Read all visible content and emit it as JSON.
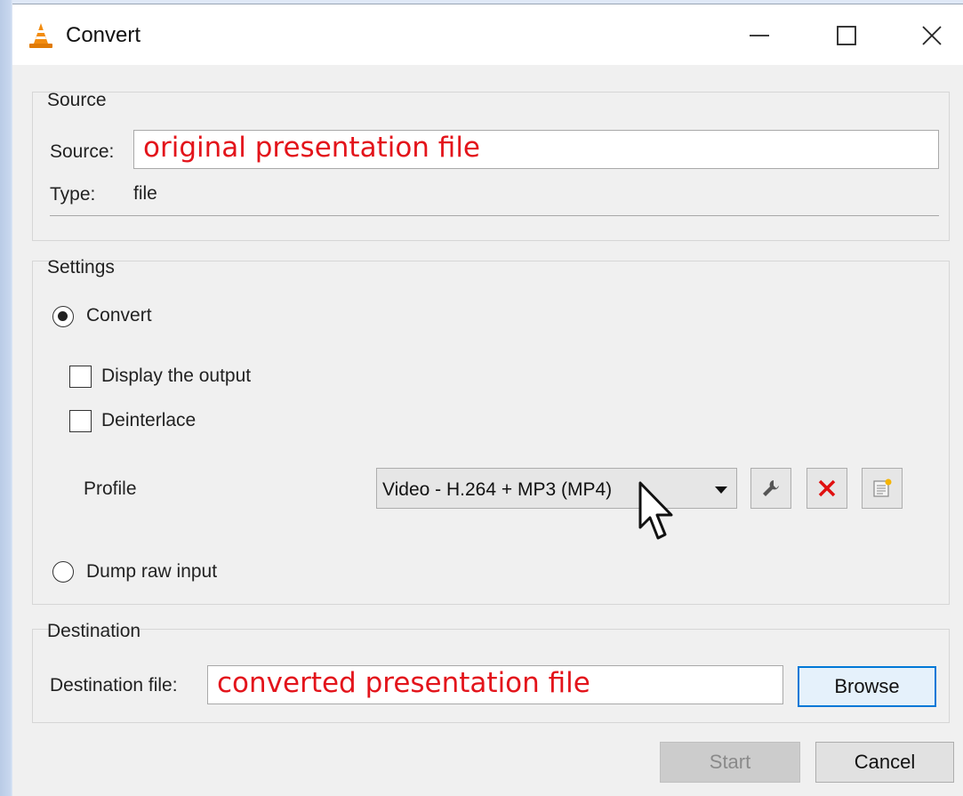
{
  "window": {
    "title": "Convert",
    "icon": "vlc-cone-icon"
  },
  "source": {
    "group_label": "Source",
    "source_label": "Source:",
    "source_value": "original presentation file",
    "type_label": "Type:",
    "type_value": "file"
  },
  "settings": {
    "group_label": "Settings",
    "convert_label": "Convert",
    "convert_selected": true,
    "display_output_label": "Display the output",
    "display_output_checked": false,
    "deinterlace_label": "Deinterlace",
    "deinterlace_checked": false,
    "profile_label": "Profile",
    "profile_value": "Video - H.264 + MP3 (MP4)",
    "profile_tools": [
      "wrench-icon",
      "delete-x-icon",
      "new-profile-icon"
    ],
    "dump_raw_label": "Dump raw input",
    "dump_raw_selected": false
  },
  "destination": {
    "group_label": "Destination",
    "file_label": "Destination file:",
    "file_value": "converted presentation file",
    "browse_label": "Browse"
  },
  "buttons": {
    "start_label": "Start",
    "start_enabled": false,
    "cancel_label": "Cancel"
  },
  "colors": {
    "annotation_text": "#e3141b",
    "focus_border": "#0078d7"
  }
}
